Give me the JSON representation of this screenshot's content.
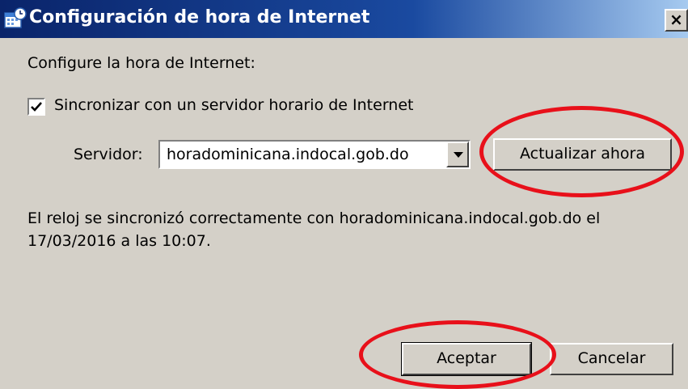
{
  "window": {
    "title": "Configuración de hora de Internet",
    "close_label": "×"
  },
  "dialog": {
    "heading": "Configure la hora de Internet:",
    "sync_checkbox": {
      "label": "Sincronizar con un servidor horario de Internet",
      "checked": true
    },
    "server_label": "Servidor:",
    "server_value": "horadominicana.indocal.gob.do",
    "update_button": "Actualizar ahora",
    "status_line1": "El reloj se sincronizó correctamente con horadominicana.indocal.gob.do el",
    "status_line2": "17/03/2016 a las 10:07.",
    "ok_button": "Aceptar",
    "cancel_button": "Cancelar"
  },
  "colors": {
    "titlebar_start": "#0a246a",
    "titlebar_end": "#a6caf0",
    "dialog_bg": "#d4d0c8",
    "annotation_red": "#e8101a"
  },
  "icons": {
    "window": "calendar-clock-icon",
    "dropdown": "chevron-down-icon",
    "check": "check-icon"
  }
}
